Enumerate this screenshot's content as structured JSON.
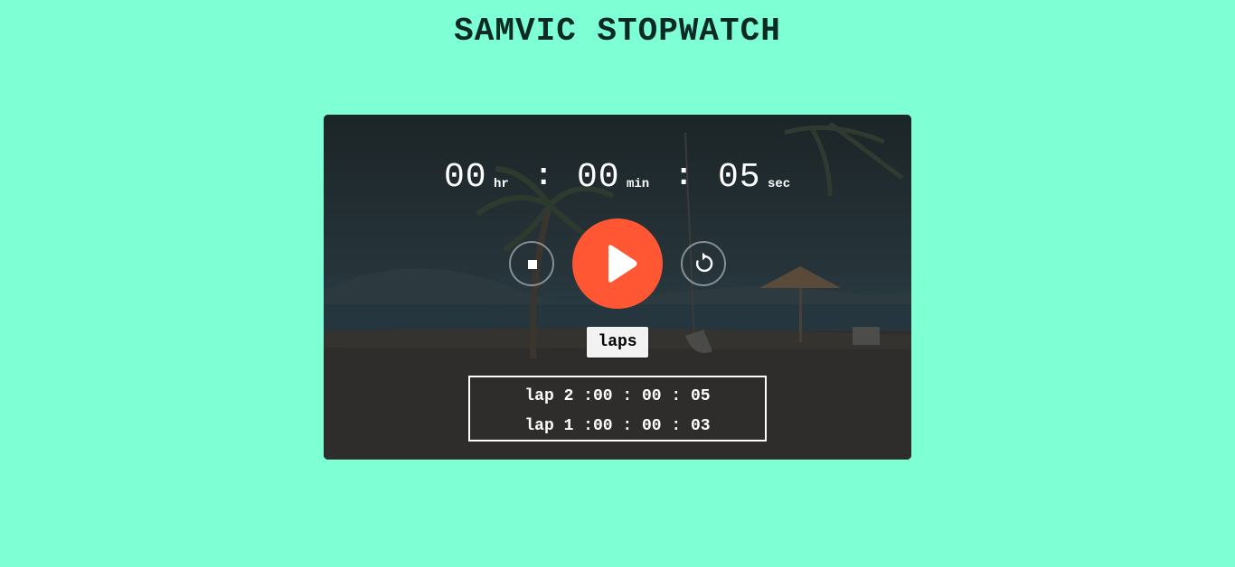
{
  "header": {
    "title": "SAMVIC STOPWATCH"
  },
  "timer": {
    "hours": "00",
    "hours_unit": "hr",
    "minutes": "00",
    "minutes_unit": "min",
    "seconds": "05",
    "seconds_unit": "sec",
    "separator": ":"
  },
  "controls": {
    "stop_icon": "stop-icon",
    "play_icon": "play-icon",
    "reset_icon": "reset-icon",
    "play_color": "#ff5733",
    "laps_label": "laps"
  },
  "laps": [
    {
      "text": "lap 2 :00 : 00 : 05"
    },
    {
      "text": "lap 1 :00 : 00 : 03"
    }
  ],
  "colors": {
    "page_background": "#7fffd4",
    "title_color": "#0b2a25"
  }
}
